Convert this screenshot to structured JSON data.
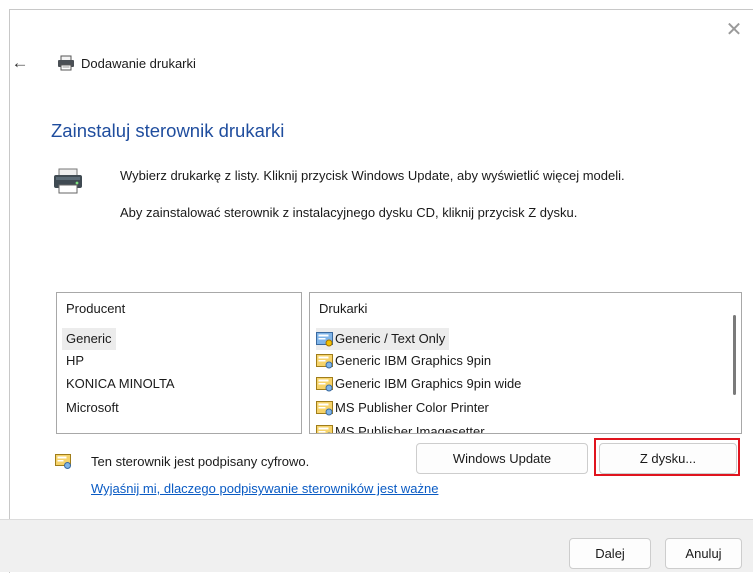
{
  "window": {
    "close_glyph": "✕"
  },
  "header": {
    "back_glyph": "←",
    "title": "Dodawanie drukarki"
  },
  "page": {
    "heading": "Zainstaluj sterownik drukarki",
    "description_1": "Wybierz drukarkę z listy. Kliknij przycisk Windows Update, aby wyświetlić więcej modeli.",
    "description_2": "Aby zainstalować sterownik z instalacyjnego dysku CD, kliknij przycisk Z dysku."
  },
  "manufacturers": {
    "header": "Producent",
    "items": [
      "Generic",
      "HP",
      "KONICA MINOLTA",
      "Microsoft"
    ],
    "selected": "Generic"
  },
  "printers": {
    "header": "Drukarki",
    "items": [
      "Generic / Text Only",
      "Generic IBM Graphics 9pin",
      "Generic IBM Graphics 9pin wide",
      "MS Publisher Color Printer",
      "MS Publisher Imagesetter"
    ],
    "selected": "Generic / Text Only"
  },
  "signature": {
    "status": "Ten sterownik jest podpisany cyfrowo.",
    "link": "Wyjaśnij mi, dlaczego podpisywanie sterowników jest ważne"
  },
  "buttons": {
    "windows_update": "Windows Update",
    "have_disk": "Z dysku...",
    "next": "Dalej",
    "cancel": "Anuluj"
  },
  "colors": {
    "accent_heading": "#1f4d9e",
    "link": "#0a5bc4",
    "highlight": "#e0141e"
  }
}
